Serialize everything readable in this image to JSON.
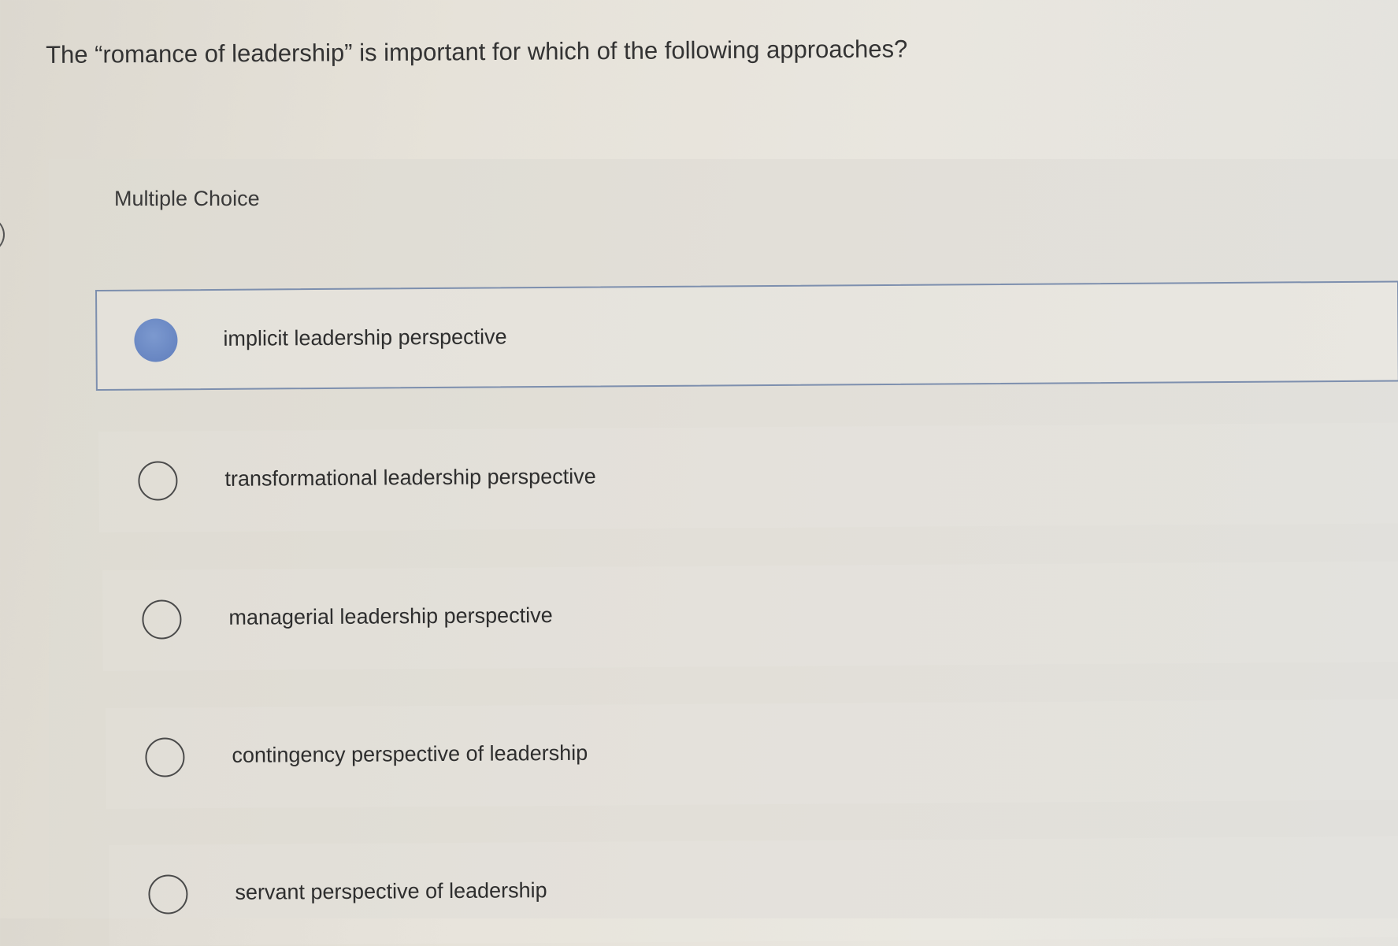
{
  "question": {
    "text": "The “romance of leadership” is important for which of the following approaches?"
  },
  "quiz": {
    "type_label": "Multiple Choice",
    "selected_index": 0,
    "options": [
      {
        "label": "implicit leadership perspective",
        "selected": true
      },
      {
        "label": "transformational leadership perspective",
        "selected": false
      },
      {
        "label": "managerial leadership perspective",
        "selected": false
      },
      {
        "label": "contingency perspective of leadership",
        "selected": false
      },
      {
        "label": "servant perspective of leadership",
        "selected": false
      }
    ]
  },
  "colors": {
    "selected_radio": "#6886c2",
    "selected_border": "#7d8fae",
    "text": "#2f2f2f"
  }
}
